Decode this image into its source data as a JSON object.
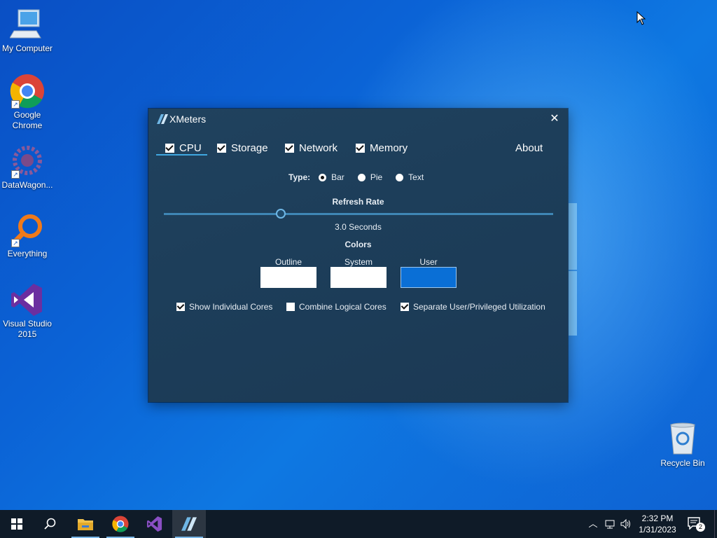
{
  "desktop": {
    "icons": [
      {
        "label": "My Computer",
        "icon": "computer-icon"
      },
      {
        "label": "Google Chrome",
        "icon": "chrome-icon"
      },
      {
        "label": "DataWagon...",
        "icon": "datawagon-icon"
      },
      {
        "label": "Everything",
        "icon": "everything-search-icon"
      },
      {
        "label": "Visual Studio 2015",
        "icon": "visual-studio-icon"
      },
      {
        "label": "Recycle Bin",
        "icon": "recycle-bin-icon"
      }
    ]
  },
  "app": {
    "title": "XMeters",
    "tabs": [
      {
        "label": "CPU",
        "checked": true,
        "active": true
      },
      {
        "label": "Storage",
        "checked": true
      },
      {
        "label": "Network",
        "checked": true
      },
      {
        "label": "Memory",
        "checked": true
      }
    ],
    "about_label": "About",
    "type": {
      "label": "Type:",
      "options": [
        "Bar",
        "Pie",
        "Text"
      ],
      "selected": "Bar"
    },
    "refresh": {
      "label": "Refresh Rate",
      "value_text": "3.0 Seconds",
      "fraction": 0.3
    },
    "colors": {
      "heading": "Colors",
      "swatches": [
        {
          "label": "Outline",
          "color": "#ffffff"
        },
        {
          "label": "System",
          "color": "#ffffff"
        },
        {
          "label": "User",
          "color": "#0a6fd6"
        }
      ]
    },
    "options": [
      {
        "label": "Show Individual Cores",
        "checked": true
      },
      {
        "label": "Combine Logical Cores",
        "checked": false
      },
      {
        "label": "Separate User/Privileged Utilization",
        "checked": true
      }
    ],
    "accent": "#3fa7e0"
  },
  "taskbar": {
    "pinned": [
      "windows-start-icon",
      "search-icon",
      "file-explorer-icon",
      "chrome-icon",
      "visual-studio-icon",
      "xmeters-icon"
    ],
    "tray": [
      "chevron-up-icon",
      "network-icon",
      "volume-icon"
    ],
    "time": "2:32 PM",
    "date": "1/31/2023",
    "notification_count": "2"
  }
}
